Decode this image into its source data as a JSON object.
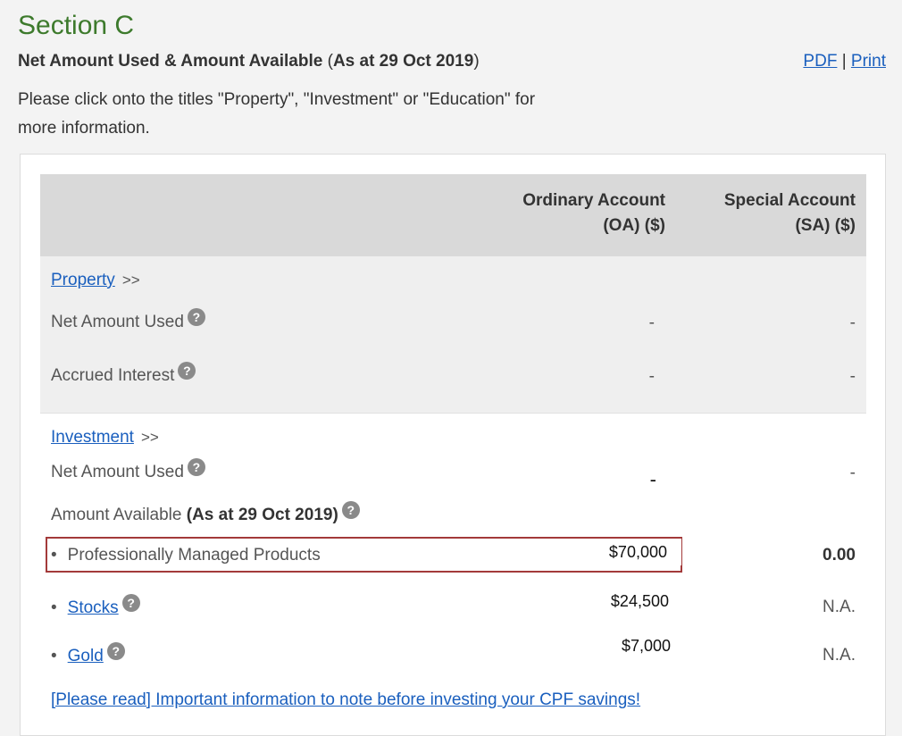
{
  "section": {
    "title": "Section C",
    "subtitle_main": "Net Amount Used & Amount Available",
    "subtitle_open": " (",
    "subtitle_asat": "As at 29 Oct 2019",
    "subtitle_close": ")",
    "pdf_label": "PDF",
    "separator": " | ",
    "print_label": "Print",
    "intro": "Please click onto the titles \"Property\", \"Investment\" or \"Education\" for more information."
  },
  "table": {
    "col_oa_line1": "Ordinary Account",
    "col_oa_line2": "(OA) ($)",
    "col_sa_line1": "Special Account",
    "col_sa_line2": "(SA) ($)"
  },
  "property": {
    "title": "Property",
    "arrows": ">>",
    "rows": [
      {
        "label": "Net Amount Used",
        "oa": "-",
        "sa": "-"
      },
      {
        "label": "Accrued Interest",
        "oa": "-",
        "sa": "-"
      }
    ]
  },
  "investment": {
    "title": "Investment",
    "arrows": ">>",
    "net_amount_label": "Net Amount Used",
    "net_amount_oa": "-",
    "net_amount_sa": "-",
    "available_label": "Amount Available ",
    "available_asat": "(As at 29 Oct 2019)",
    "bullet": "•",
    "items": [
      {
        "label": "Professionally Managed Products",
        "oa": "$70,000",
        "sa": "0.00"
      },
      {
        "label": "Stocks",
        "oa": "$24,500",
        "sa": "N.A."
      },
      {
        "label": "Gold",
        "oa": "$7,000",
        "sa": "N.A."
      }
    ],
    "note_link": "[Please read] Important information to note before investing your CPF savings!"
  },
  "icons": {
    "help": "?"
  },
  "colors": {
    "section_title": "#3d7a2c",
    "link": "#1a5fbe",
    "highlight_border": "#a33a3a"
  }
}
